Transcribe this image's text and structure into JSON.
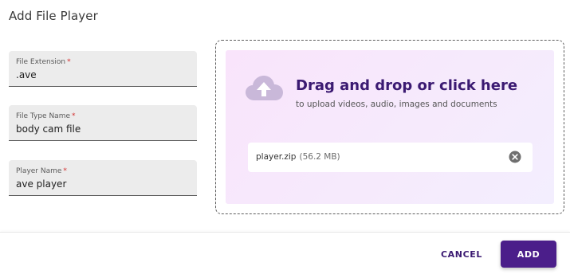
{
  "dialog": {
    "title": "Add File Player"
  },
  "form": {
    "fields": [
      {
        "label": "File Extension",
        "required_mark": "*",
        "value": ".ave"
      },
      {
        "label": "File Type Name",
        "required_mark": "*",
        "value": "body cam file"
      },
      {
        "label": "Player Name",
        "required_mark": "*",
        "value": "ave player"
      }
    ]
  },
  "dropzone": {
    "title": "Drag and drop or click here",
    "subtitle": "to upload videos, audio, images and documents",
    "icon": "cloud-upload-icon",
    "file": {
      "name": "player.zip",
      "size": "(56.2 MB)",
      "remove_icon": "close-circle-icon"
    }
  },
  "actions": {
    "cancel_label": "CANCEL",
    "add_label": "ADD"
  },
  "colors": {
    "accent": "#4b1e8a",
    "title_purple": "#3b1a72",
    "required": "#d32f2f",
    "dropzone_bg": "#f6eafc"
  }
}
